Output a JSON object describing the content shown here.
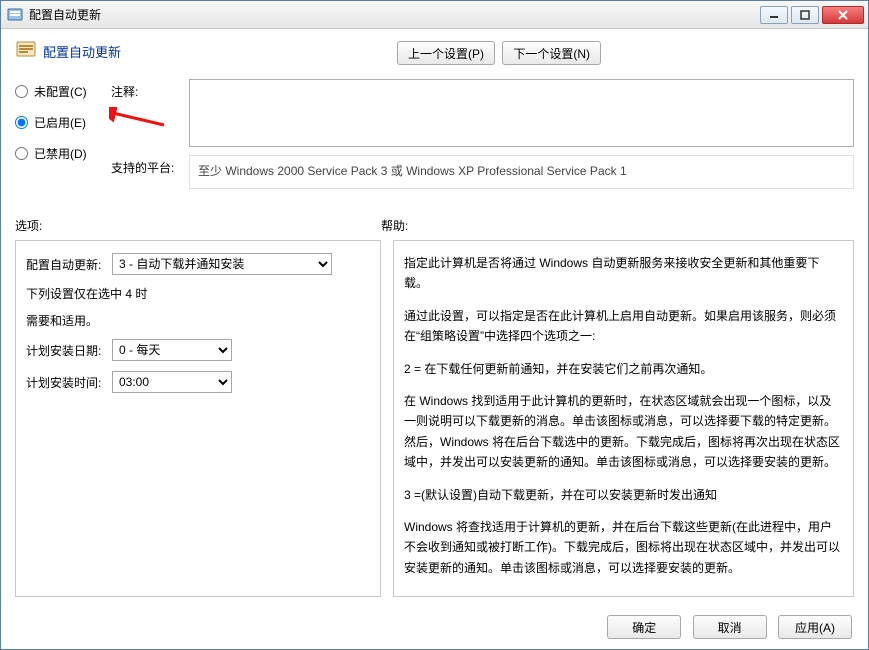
{
  "window": {
    "title": "配置自动更新"
  },
  "header": {
    "title": "配置自动更新"
  },
  "nav": {
    "prev": "上一个设置(P)",
    "next": "下一个设置(N)"
  },
  "radios": {
    "not_configured": "未配置(C)",
    "enabled": "已启用(E)",
    "disabled": "已禁用(D)",
    "selected": "enabled"
  },
  "fields": {
    "comment_label": "注释:",
    "comment_value": "",
    "platform_label": "支持的平台:",
    "platform_value": "至少 Windows 2000 Service Pack 3 或 Windows XP Professional Service Pack 1"
  },
  "sections": {
    "options_label": "选项:",
    "help_label": "帮助:"
  },
  "options": {
    "auto_update_label": "配置自动更新:",
    "auto_update_value": "3 - 自动下载并通知安装",
    "note_line1": "下列设置仅在选中 4 时",
    "note_line2": "需要和适用。",
    "install_day_label": "计划安装日期:",
    "install_day_value": "0 - 每天",
    "install_time_label": "计划安装时间:",
    "install_time_value": "03:00"
  },
  "help": {
    "p1": "指定此计算机是否将通过 Windows 自动更新服务来接收安全更新和其他重要下载。",
    "p2": "通过此设置，可以指定是否在此计算机上启用自动更新。如果启用该服务，则必须在“组策略设置”中选择四个选项之一:",
    "p3": "2 = 在下载任何更新前通知，并在安装它们之前再次通知。",
    "p4": "在 Windows 找到适用于此计算机的更新时，在状态区域就会出现一个图标，以及一则说明可以下载更新的消息。单击该图标或消息，可以选择要下载的特定更新。然后，Windows 将在后台下载选中的更新。下载完成后，图标将再次出现在状态区域中，并发出可以安装更新的通知。单击该图标或消息，可以选择要安装的更新。",
    "p5": "3 =(默认设置)自动下载更新，并在可以安装更新时发出通知",
    "p6": "Windows 将查找适用于计算机的更新，并在后台下载这些更新(在此进程中，用户不会收到通知或被打断工作)。下载完成后，图标将出现在状态区域中，并发出可以安装更新的通知。单击该图标或消息，可以选择要安装的更新。"
  },
  "footer": {
    "ok": "确定",
    "cancel": "取消",
    "apply": "应用(A)"
  }
}
